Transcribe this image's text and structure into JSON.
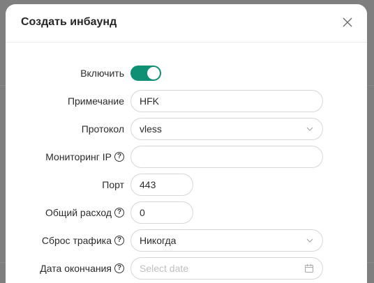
{
  "modal": {
    "title": "Создать инбаунд"
  },
  "form": {
    "enable": {
      "label": "Включить",
      "checked": true
    },
    "remark": {
      "label": "Примечание",
      "value": "HFK"
    },
    "protocol": {
      "label": "Протокол",
      "value": "vless"
    },
    "monitor_ip": {
      "label": "Мониторинг IP",
      "value": ""
    },
    "port": {
      "label": "Порт",
      "value": "443"
    },
    "total_usage": {
      "label": "Общий расход",
      "value": "0"
    },
    "traffic_reset": {
      "label": "Сброс трафика",
      "value": "Никогда"
    },
    "expiry_date": {
      "label": "Дата окончания",
      "placeholder": "Select date"
    }
  },
  "help_glyph": "?",
  "colors": {
    "accent": "#0f8f73",
    "overlay": "#7f7f7f"
  }
}
